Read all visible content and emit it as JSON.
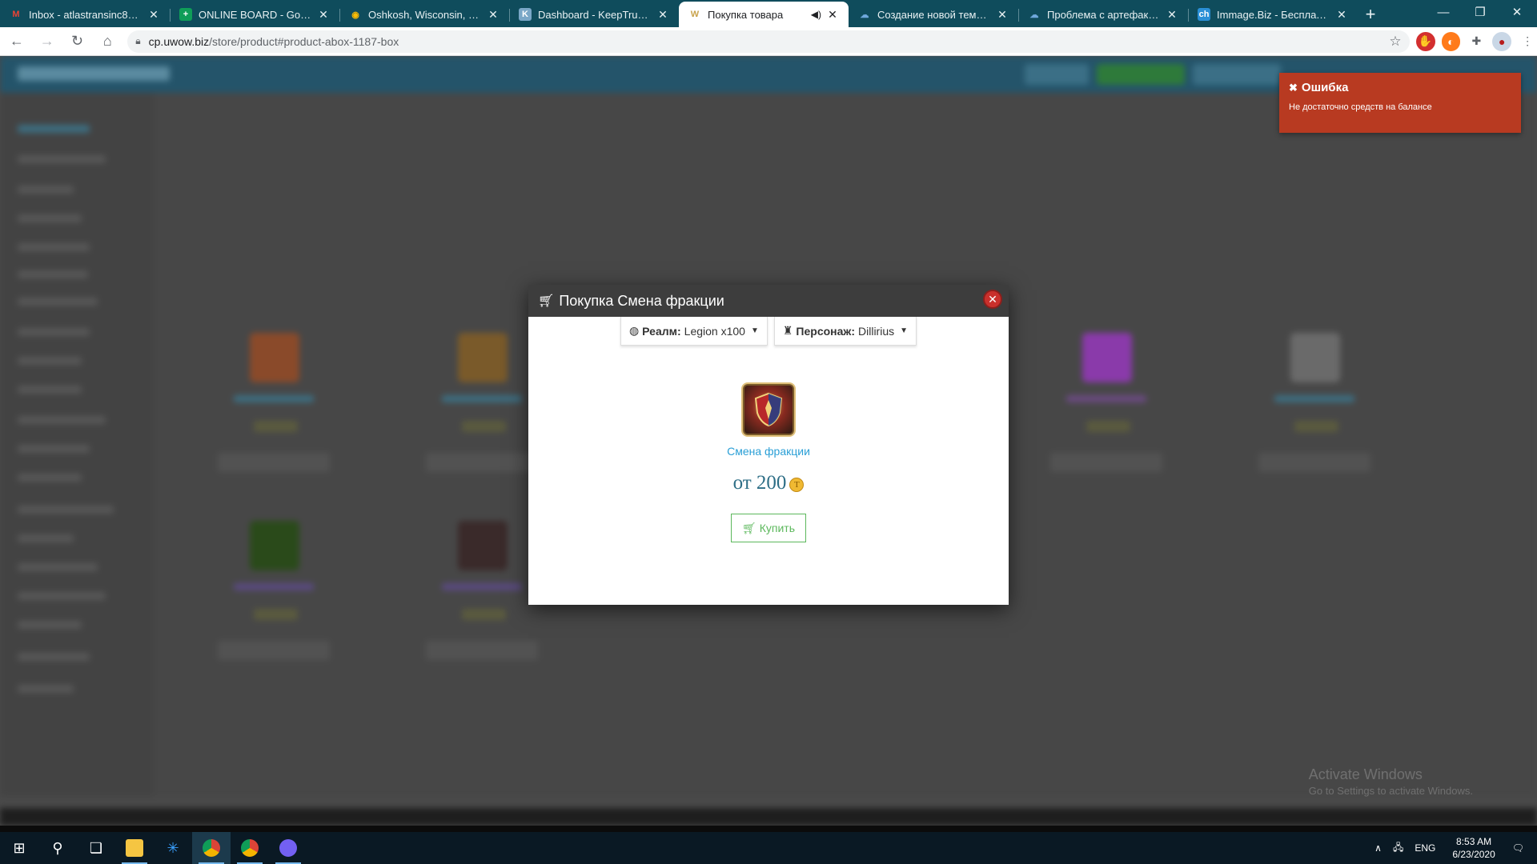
{
  "browser": {
    "tabs": [
      {
        "title": "Inbox - atlastransinc87@gm",
        "favicon": "gmail-icon",
        "favicon_color": "#ea4335",
        "active": false
      },
      {
        "title": "ONLINE BOARD - Google S",
        "favicon": "sheets-icon",
        "favicon_color": "#0f9d58",
        "active": false
      },
      {
        "title": "Oshkosh, Wisconsin, USA to",
        "favicon": "maps-icon",
        "favicon_color": "#fbbc04",
        "active": false
      },
      {
        "title": "Dashboard - KeepTruckin",
        "favicon": "keeptruckin-icon",
        "favicon_color": "#7aa7c7",
        "active": false
      },
      {
        "title": "Покупка товара",
        "favicon": "wow-icon",
        "favicon_color": "#c8a24a",
        "active": true
      },
      {
        "title": "Создание новой темы - Ф",
        "favicon": "forum-icon",
        "favicon_color": "#6fa8dc",
        "active": false
      },
      {
        "title": "Проблема с артефактом и",
        "favicon": "forum-icon",
        "favicon_color": "#6fa8dc",
        "active": false
      },
      {
        "title": "Immage.Biz - Бесплатный",
        "favicon": "immage-icon",
        "favicon_color": "#2a8fd6",
        "active": false
      }
    ],
    "url_host": "cp.uwow.biz",
    "url_path": "/store/product#product-abox-1187-box"
  },
  "modal": {
    "title": "Покупка Смена фракции",
    "realm_label": "Реалм:",
    "realm_value": "Legion x100",
    "character_label": "Персонаж:",
    "character_value": "Dillirius",
    "product_name": "Смена фракции",
    "price": "от 200",
    "buy_label": "Купить"
  },
  "toast": {
    "title": "Ошибка",
    "message": "Не достаточно средств на балансе"
  },
  "watermark": {
    "title": "Activate Windows",
    "subtitle": "Go to Settings to activate Windows."
  },
  "taskbar": {
    "language": "ENG",
    "time": "8:53 AM",
    "date": "6/23/2020"
  },
  "colors": {
    "accent_link": "#2a9fd6",
    "buy_green": "#5cb85c",
    "error_red": "#b83a21",
    "tabstrip": "#0f4c5c"
  }
}
